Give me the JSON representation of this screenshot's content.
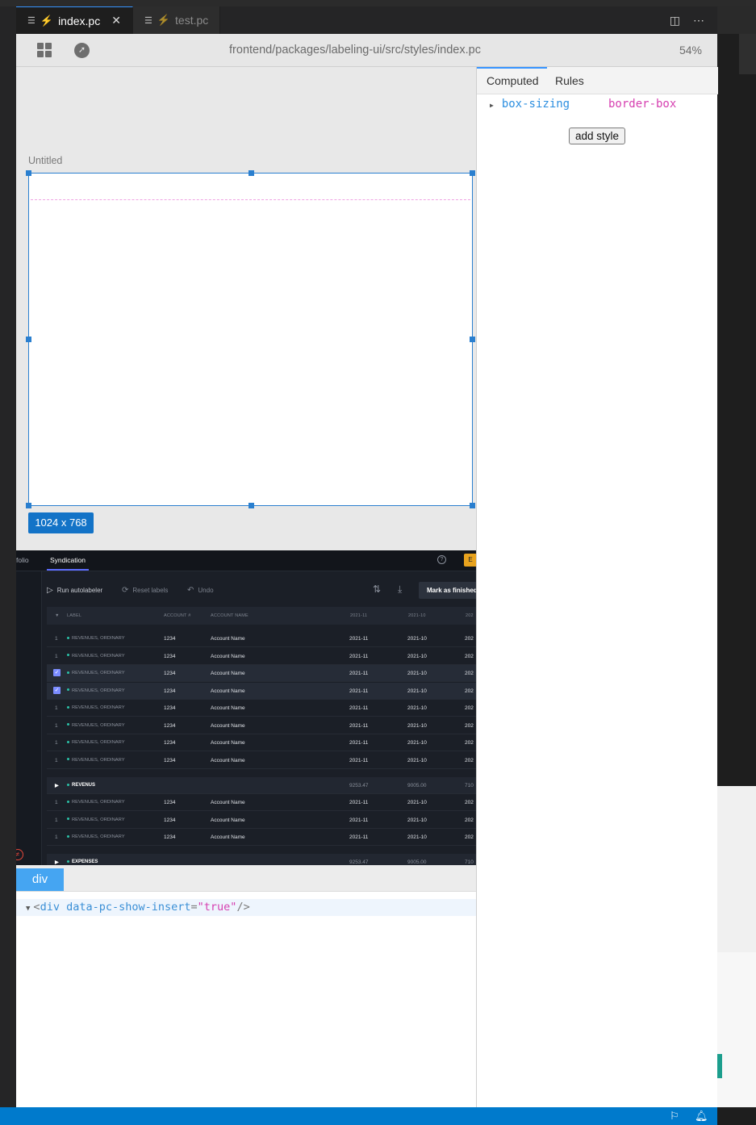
{
  "tabs": [
    {
      "label": "index.pc",
      "active": true
    },
    {
      "label": "test.pc",
      "active": false
    }
  ],
  "toolbar": {
    "file_path": "frontend/packages/labeling-ui/src/styles/index.pc",
    "zoom": "54%"
  },
  "canvas": {
    "frame_title": "Untitled",
    "size_badge": "1024 x 768"
  },
  "preview": {
    "nav": {
      "partial_item": "folio",
      "active_item": "Syndication",
      "avatar_letter": "E"
    },
    "toolbar": {
      "run": "Run autolabeler",
      "reset": "Reset labels",
      "undo": "Undo",
      "mark": "Mark as finished"
    },
    "columns": [
      "LABEL",
      "ACCOUNT #",
      "ACCOUNT NAME",
      "2021-11",
      "2021-10",
      "202"
    ],
    "rows": [
      {
        "num": "1",
        "label": "REVENUES, ORDINARY",
        "account": "1234",
        "name": "Account Name",
        "c1": "2021-11",
        "c2": "2021-10",
        "c3": "202"
      },
      {
        "num": "1",
        "label": "REVENUES, ORDINARY",
        "account": "1234",
        "name": "Account Name",
        "c1": "2021-11",
        "c2": "2021-10",
        "c3": "202"
      },
      {
        "num": "",
        "label": "REVENUES, ORDINARY",
        "account": "1234",
        "name": "Account Name",
        "c1": "2021-11",
        "c2": "2021-10",
        "c3": "202"
      },
      {
        "num": "",
        "label": "REVENUES, ORDINARY",
        "account": "1234",
        "name": "Account Name",
        "c1": "2021-11",
        "c2": "2021-10",
        "c3": "202"
      },
      {
        "num": "1",
        "label": "REVENUES, ORDINARY",
        "account": "1234",
        "name": "Account Name",
        "c1": "2021-11",
        "c2": "2021-10",
        "c3": "202"
      },
      {
        "num": "1",
        "label": "REVENUES, ORDINARY",
        "account": "1234",
        "name": "Account Name",
        "c1": "2021-11",
        "c2": "2021-10",
        "c3": "202"
      },
      {
        "num": "1",
        "label": "REVENUES, ORDINARY",
        "account": "1234",
        "name": "Account Name",
        "c1": "2021-11",
        "c2": "2021-10",
        "c3": "202"
      },
      {
        "num": "1",
        "label": "REVENUES, ORDINARY",
        "account": "1234",
        "name": "Account Name",
        "c1": "2021-11",
        "c2": "2021-10",
        "c3": "202"
      }
    ],
    "group_revenus": {
      "label": "REVENUS",
      "c1": "9253.47",
      "c2": "9005.00",
      "c3": "710"
    },
    "rows2": [
      {
        "num": "1",
        "label": "REVENUES, ORDINARY",
        "account": "1234",
        "name": "Account Name",
        "c1": "2021-11",
        "c2": "2021-10",
        "c3": "202"
      },
      {
        "num": "1",
        "label": "REVENUES, ORDINARY",
        "account": "1234",
        "name": "Account Name",
        "c1": "2021-11",
        "c2": "2021-10",
        "c3": "202"
      },
      {
        "num": "1",
        "label": "REVENUES, ORDINARY",
        "account": "1234",
        "name": "Account Name",
        "c1": "2021-11",
        "c2": "2021-10",
        "c3": "202"
      }
    ],
    "group_expenses": {
      "label": "EXPENSES",
      "c1": "9253.47",
      "c2": "9005.00",
      "c3": "710"
    }
  },
  "layers": {
    "tab_label": "div",
    "code": {
      "open": "<",
      "tag": "div",
      "attr": "data-pc-show-insert",
      "eq": "=",
      "value": "\"true\"",
      "close": "/>"
    }
  },
  "inspector": {
    "tabs": [
      "Computed",
      "Rules"
    ],
    "prop_name": "box-sizing",
    "prop_value": "border-box",
    "add_style": "add style"
  },
  "colors": {
    "accent": "#007acc",
    "selection": "#2a7fcf",
    "teal_dot": "#2bc1a7"
  }
}
